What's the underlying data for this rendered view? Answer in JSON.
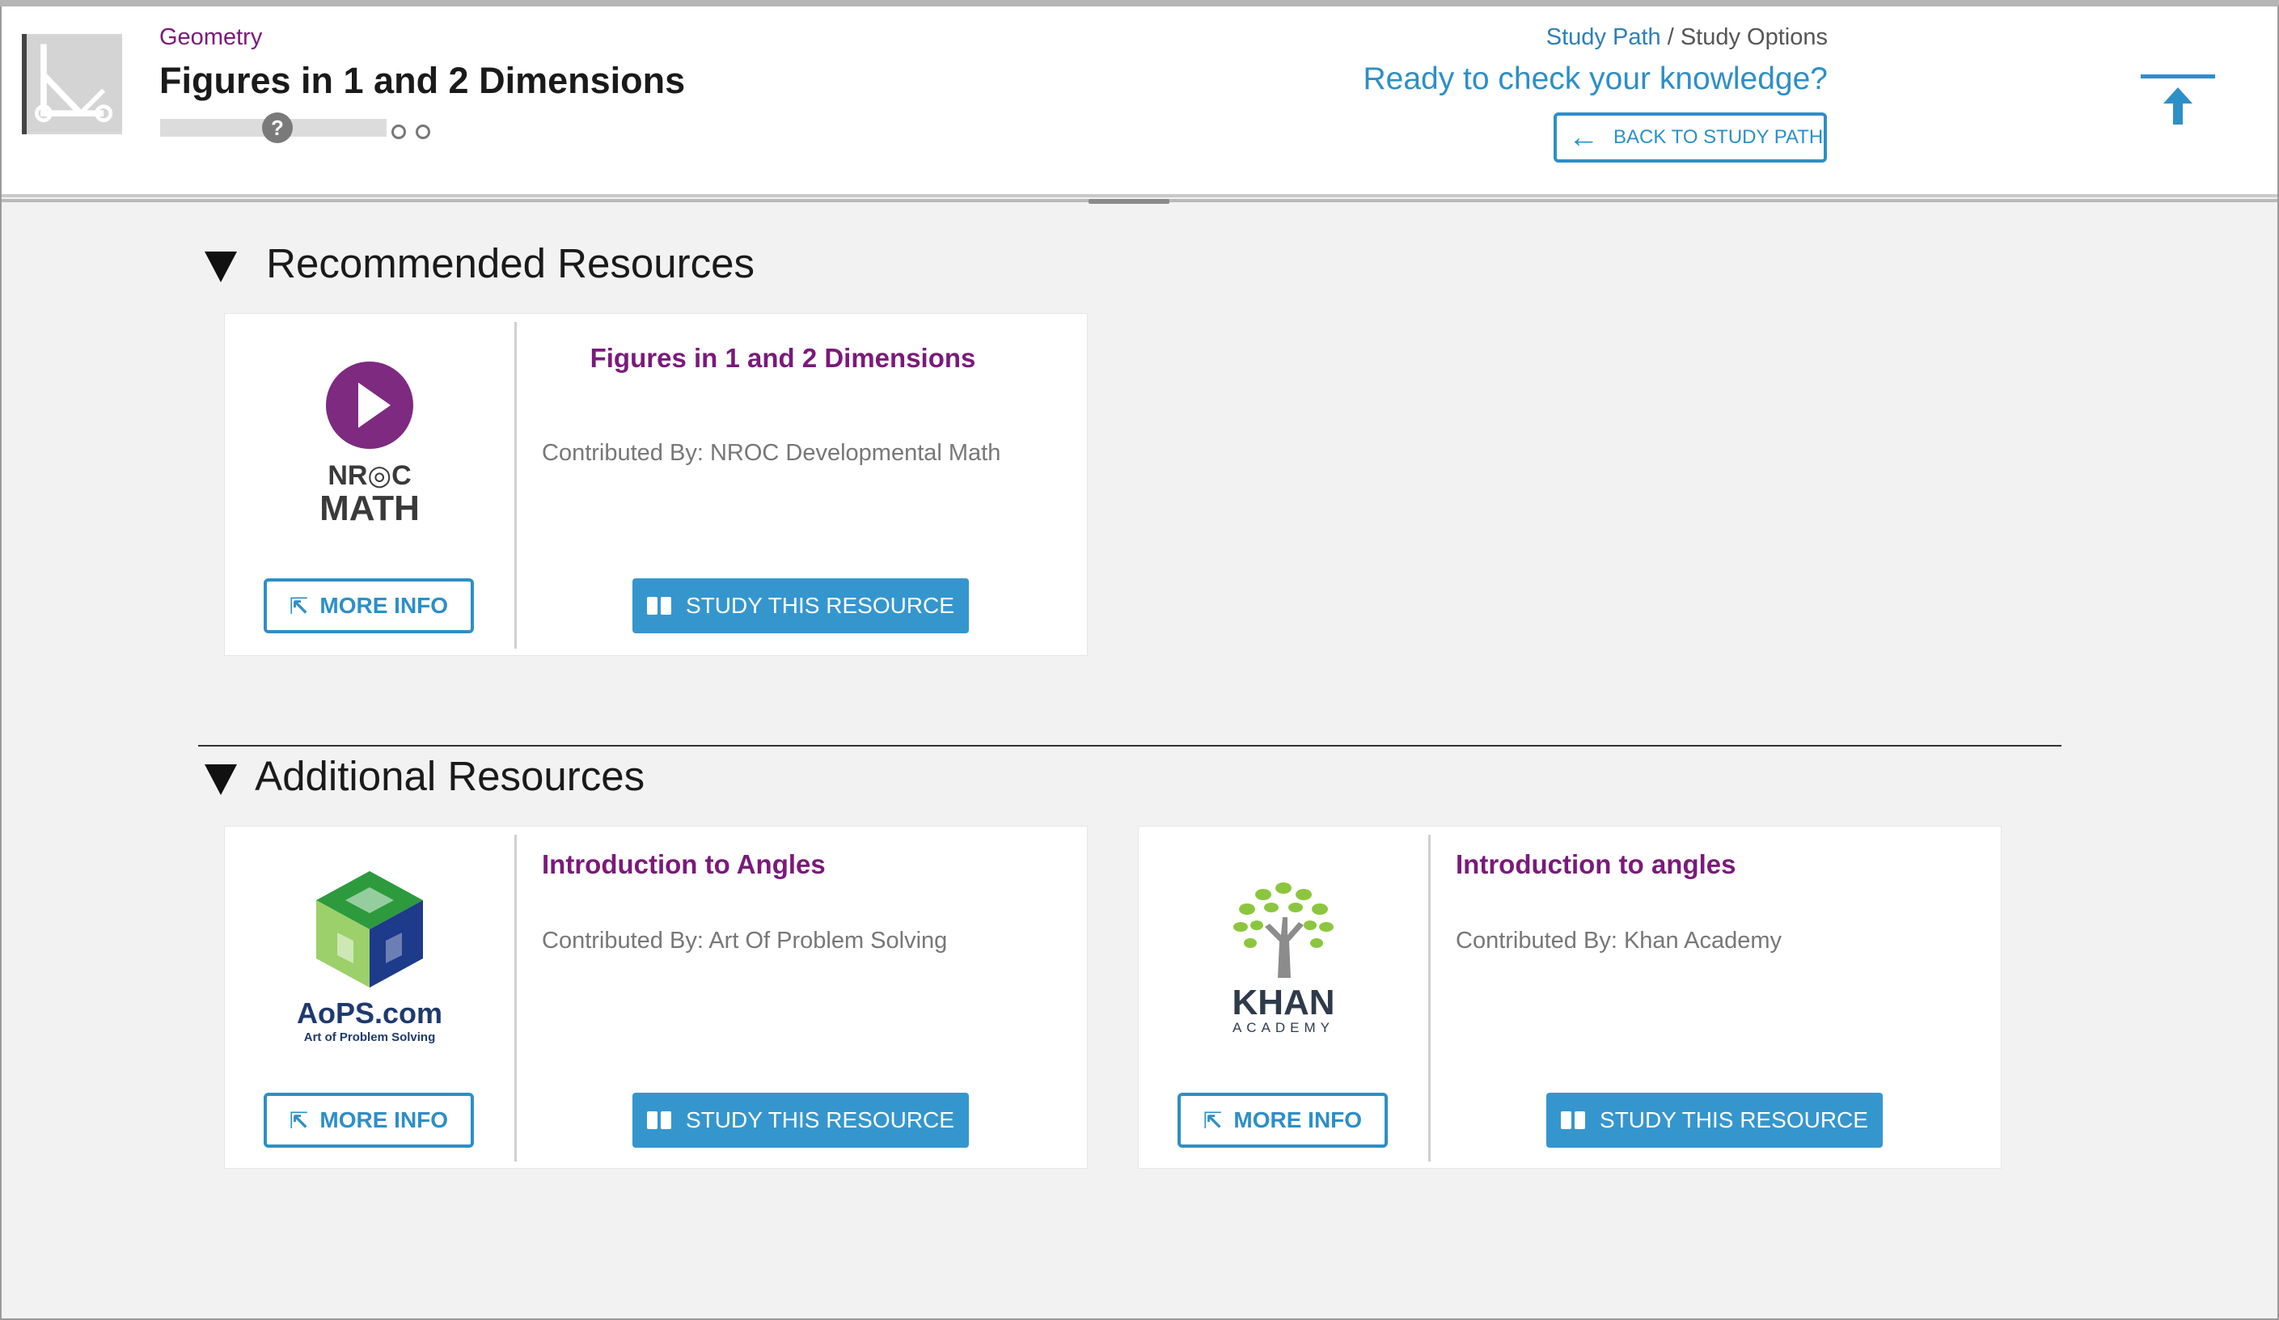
{
  "header": {
    "subject": "Geometry",
    "title": "Figures in 1 and 2 Dimensions",
    "progress_marker": "?",
    "breadcrumb": {
      "study_path": "Study Path",
      "separator": "/",
      "study_options": "Study Options"
    },
    "prompt": "Ready to check your knowledge?",
    "back_button": "BACK TO STUDY PATH"
  },
  "sections": {
    "recommended": {
      "title": "Recommended Resources"
    },
    "additional": {
      "title": "Additional Resources"
    }
  },
  "resources": [
    {
      "title": "Figures in 1 and 2 Dimensions",
      "contributor": "Contributed By: NROC Developmental Math",
      "logo_text_1": "NR◎C",
      "logo_text_2": "MATH",
      "more_info": "MORE INFO",
      "study": "STUDY THIS RESOURCE"
    },
    {
      "title": "Introduction to Angles",
      "contributor": "Contributed By: Art Of Problem Solving",
      "logo_text_1": "AoPS.com",
      "logo_text_2": "Art of Problem Solving",
      "more_info": "MORE INFO",
      "study": "STUDY THIS RESOURCE"
    },
    {
      "title": "Introduction to angles",
      "contributor": "Contributed By: Khan Academy",
      "logo_text_1": "KHAN",
      "logo_text_2": "ACADEMY",
      "more_info": "MORE INFO",
      "study": "STUDY THIS RESOURCE"
    }
  ],
  "colors": {
    "accent": "#2d8fc7",
    "title_purple": "#7a1a7a",
    "button_fill": "#3596ce"
  }
}
